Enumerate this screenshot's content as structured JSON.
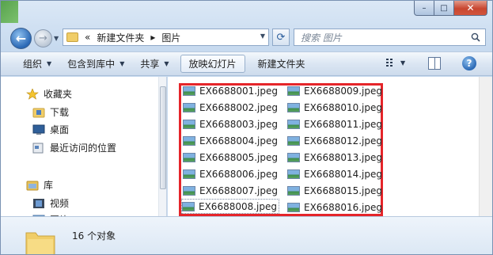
{
  "window": {
    "controls": {
      "minimize": "–",
      "maximize": "□",
      "close": "✕"
    }
  },
  "address_bar": {
    "prefix": "«",
    "crumbs": [
      "新建文件夹",
      "图片"
    ],
    "separator": "▸"
  },
  "search": {
    "placeholder": "搜索 图片"
  },
  "toolbar": {
    "organize": "组织",
    "include_in_library": "包含到库中",
    "share": "共享",
    "slideshow": "放映幻灯片",
    "new_folder": "新建文件夹"
  },
  "nav": {
    "favorites": "收藏夹",
    "downloads": "下载",
    "desktop": "桌面",
    "recent": "最近访问的位置",
    "libraries": "库",
    "videos": "视频",
    "pictures": "图片"
  },
  "files": [
    "EX6688001.jpeg",
    "EX6688002.jpeg",
    "EX6688003.jpeg",
    "EX6688004.jpeg",
    "EX6688005.jpeg",
    "EX6688006.jpeg",
    "EX6688007.jpeg",
    "EX6688008.jpeg",
    "EX6688009.jpeg",
    "EX6688010.jpeg",
    "EX6688011.jpeg",
    "EX6688012.jpeg",
    "EX6688013.jpeg",
    "EX6688014.jpeg",
    "EX6688015.jpeg",
    "EX6688016.jpeg"
  ],
  "status": {
    "count_text": "16 个对象"
  },
  "colors": {
    "highlight_border": "#e5252a",
    "accent": "#2a68b5"
  }
}
